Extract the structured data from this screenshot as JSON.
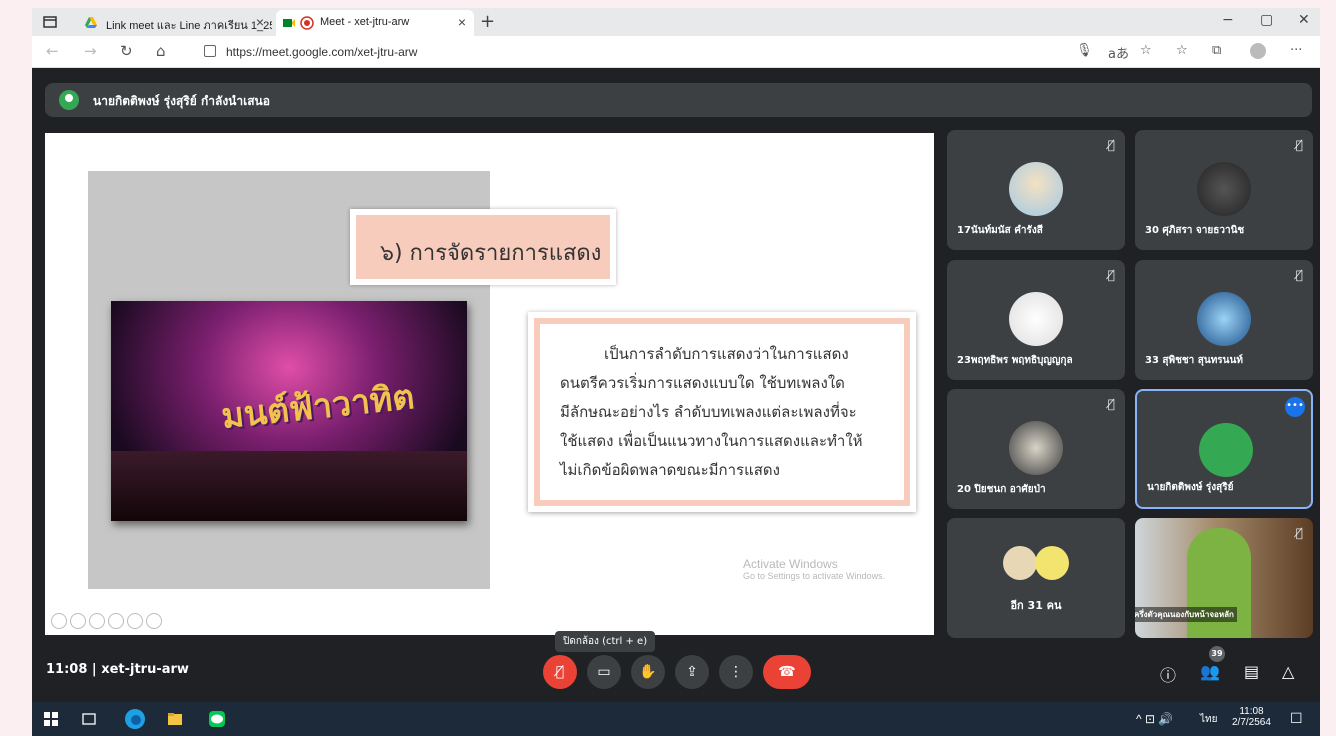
{
  "browser": {
    "tabs": [
      {
        "title": "Link meet และ Line ภาคเรียน 1_25(",
        "close": "×"
      },
      {
        "title": "Meet - xet-jtru-arw",
        "close": "×"
      }
    ],
    "new_tab": "+",
    "url": "https://meet.google.com/xet-jtru-arw",
    "window_controls": [
      "−",
      "▢",
      "✕"
    ]
  },
  "meet": {
    "presenter_banner": "นายกิตติพงษ์ รุ่งสุริย์ กำลังนำเสนอ",
    "slide": {
      "title": "๖) การจัดรายการแสดง",
      "paragraph_lines": [
        "เป็นการลำดับการแสดงว่าในการแสดง",
        "ดนตรีควรเริ่มการแสดงแบบใด  ใช้บทเพลงใด",
        "มีลักษณะอย่างไร  ลำดับบทเพลงแต่ละเพลงที่จะ",
        "ใช้แสดง  เพื่อเป็นแนวทางในการแสดงและทำให้",
        "ไม่เกิดข้อผิดพลาดขณะมีการแสดง"
      ],
      "photo_logo": "มนต์ฟ้าวาทิต",
      "activate_title": "Activate Windows",
      "activate_sub": "Go to Settings to activate Windows."
    },
    "participants": [
      {
        "name": "17นันท์มนัส คำรังสี"
      },
      {
        "name": "30 ศุภิสรา จายธวานิช"
      },
      {
        "name": "23พฤทธิพร พฤทธิบุญญกุล"
      },
      {
        "name": "33 สุพิชชา สุนทรนนท์"
      },
      {
        "name": "20 ปิยชนก อาศัยป่า"
      },
      {
        "name": "นายกิตติพงษ์ รุ่งสุริย์"
      }
    ],
    "more_participants": "อีก 31 คน",
    "self_view_caption": "ครึ่งตัวคุณนองกับหน้าจอหลัก",
    "tooltip": "ปิดกล้อง (ctrl + e)",
    "time": "11:08",
    "meeting_code": "xet-jtru-arw",
    "participant_count": "39",
    "colors": {
      "end_call": "#ea4335",
      "active_border": "#8ab4f8",
      "bg": "#202124",
      "tile": "#3c4043"
    }
  },
  "taskbar": {
    "language": "ไทย",
    "clock_time": "11:08",
    "clock_date": "2/7/2564"
  }
}
